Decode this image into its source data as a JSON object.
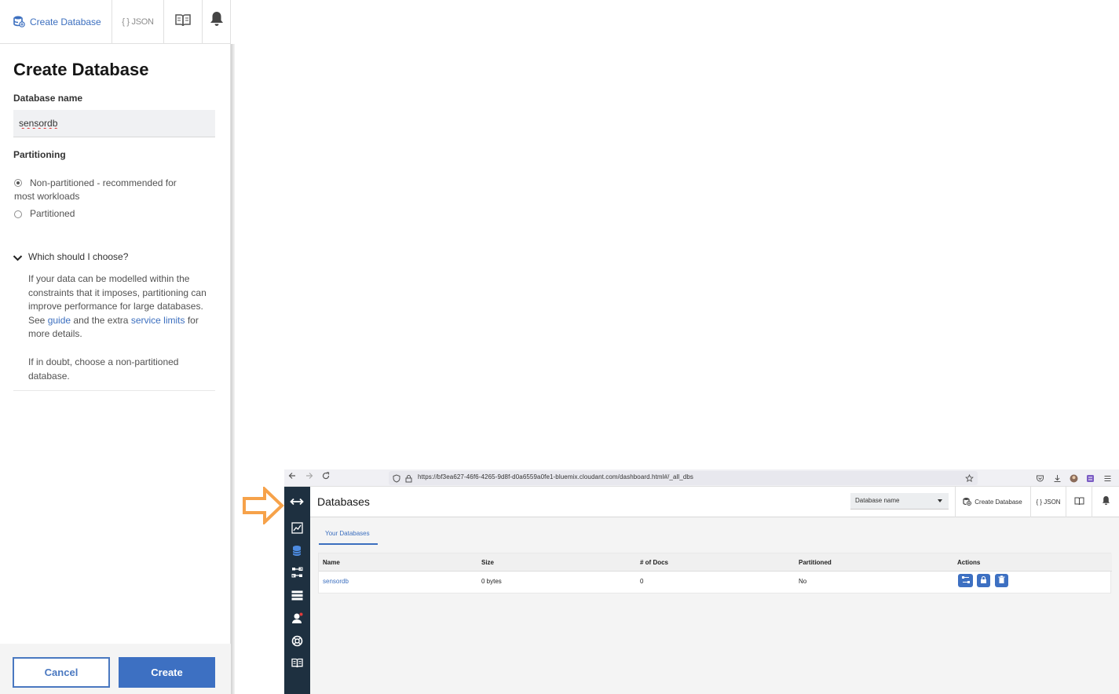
{
  "left_panel": {
    "toolbar": {
      "create_label": "Create Database",
      "json_label": "{ } JSON"
    },
    "title": "Create Database",
    "db_name_label": "Database name",
    "db_name_value": "sensordb",
    "partitioning_label": "Partitioning",
    "options": [
      {
        "label": "Non-partitioned - recommended for most workloads",
        "selected": true
      },
      {
        "label": "Partitioned",
        "selected": false
      }
    ],
    "accordion": {
      "title": "Which should I choose?",
      "body_1": "If your data can be modelled within the constraints that it imposes, partitioning can improve performance for large databases. See",
      "link_guide": "guide",
      "body_2": "and the extra",
      "link_limits": "service limits",
      "body_3": "for more details.",
      "body_para2": "If in doubt, choose a non-partitioned database."
    },
    "cancel_label": "Cancel",
    "create_label": "Create"
  },
  "browser": {
    "url": "https://bf3ea627-46f6-4265-9d8f-d0a6559a0fe1-bluemix.cloudant.com/dashboard.html#/_all_dbs",
    "page_title": "Databases",
    "db_select_placeholder": "Database name",
    "header_create_label": "Create Database",
    "header_json_label": "{ } JSON",
    "tab_label": "Your Databases",
    "table": {
      "columns": [
        "Name",
        "Size",
        "# of Docs",
        "Partitioned",
        "Actions"
      ],
      "rows": [
        {
          "name": "sensordb",
          "size": "0 bytes",
          "docs": "0",
          "partitioned": "No"
        }
      ]
    }
  },
  "colors": {
    "accent": "#3d70c2",
    "arrow": "#f6a24a",
    "sidenav": "#1e3040"
  }
}
